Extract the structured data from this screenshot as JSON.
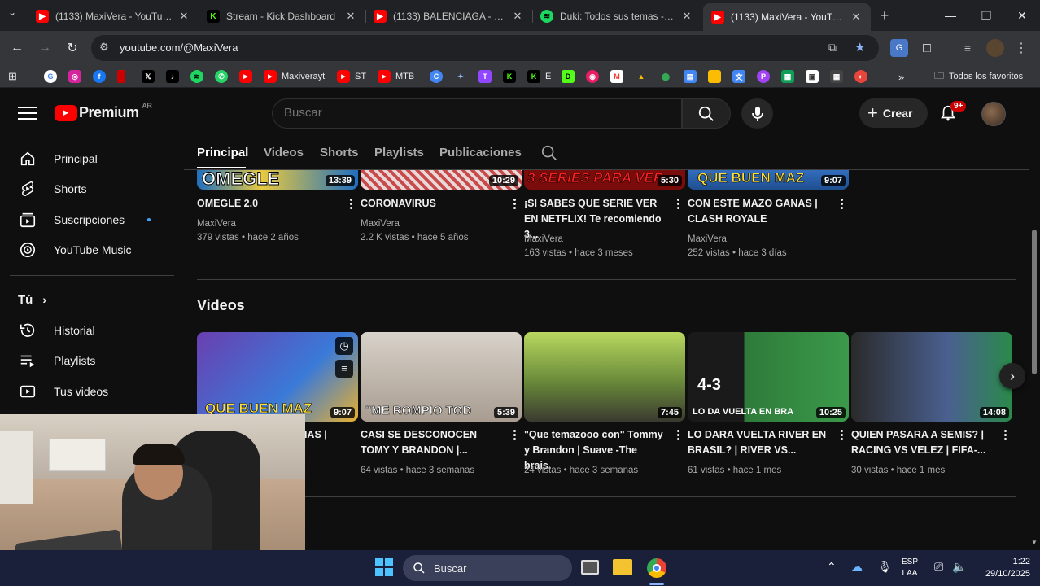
{
  "browser": {
    "tabs": [
      {
        "title": "(1133) MaxiVera - YouTube",
        "favicon": "youtube-icon",
        "color": "#ff0000"
      },
      {
        "title": "Stream - Kick Dashboard",
        "favicon": "kick-icon",
        "color": "#53fc18"
      },
      {
        "title": "(1133) BALENCIAGA - SIZZ",
        "favicon": "youtube-icon",
        "color": "#ff0000"
      },
      {
        "title": "Duki: Todos sus temas - pla",
        "favicon": "spotify-icon",
        "color": "#1ed760"
      },
      {
        "title": "(1133) MaxiVera - YouTube",
        "favicon": "youtube-icon",
        "color": "#ff0000",
        "active": true
      }
    ],
    "new_tab": "+",
    "url": "youtube.com/@MaxiVera",
    "bookmarks": [
      {
        "label": "",
        "icon": "google-icon"
      },
      {
        "label": "",
        "icon": "instagram-icon"
      },
      {
        "label": "",
        "icon": "facebook-icon"
      },
      {
        "label": "",
        "icon": "bookmark-red-icon"
      },
      {
        "label": "",
        "icon": "x-icon"
      },
      {
        "label": "",
        "icon": "tiktok-icon"
      },
      {
        "label": "",
        "icon": "spotify-icon"
      },
      {
        "label": "",
        "icon": "whatsapp-icon"
      },
      {
        "label": "",
        "icon": "youtube-icon"
      },
      {
        "label": "Maxiverayt",
        "icon": "youtube-icon"
      },
      {
        "label": "ST",
        "icon": "youtube-icon"
      },
      {
        "label": "MTB",
        "icon": "youtube-icon"
      },
      {
        "label": "E",
        "icon": "kick-icon"
      }
    ],
    "all_bookmarks": "Todos los favoritos"
  },
  "youtube": {
    "logo_text": "Premium",
    "logo_country": "AR",
    "search_placeholder": "Buscar",
    "create_label": "Crear",
    "notif_count": "9+",
    "sidebar": [
      {
        "label": "Principal",
        "icon": "home-icon"
      },
      {
        "label": "Shorts",
        "icon": "shorts-icon"
      },
      {
        "label": "Suscripciones",
        "icon": "subscriptions-icon"
      },
      {
        "label": "YouTube Music",
        "icon": "youtube-music-icon"
      }
    ],
    "you_section": "Tú",
    "sidebar2": [
      {
        "label": "Historial",
        "icon": "history-icon"
      },
      {
        "label": "Playlists",
        "icon": "playlists-icon"
      },
      {
        "label": "Tus videos",
        "icon": "your-videos-icon"
      }
    ],
    "channel_tabs": [
      "Principal",
      "Videos",
      "Shorts",
      "Playlists",
      "Publicaciones"
    ],
    "row1": [
      {
        "title": "OMEGLE 2.0",
        "channel": "MaxiVera",
        "meta": "379 vistas • hace 2 años",
        "duration": "13:39",
        "thumb_text": "OMEGLE",
        "thumb_color": "#2a8fd8"
      },
      {
        "title": "CORONAVIRUS",
        "channel": "MaxiVera",
        "meta": "2.2 K vistas • hace 5 años",
        "duration": "10:29",
        "thumb_text": "",
        "thumb_color": "#b83a3a"
      },
      {
        "title": "¡SI SABES QUE SERIE VER EN NETFLIX! Te recomiendo 3...",
        "channel": "MaxiVera",
        "meta": "163 vistas • hace 3 meses",
        "duration": "5:30",
        "thumb_text": "3 SERIES PARA VER",
        "thumb_color": "#8a1010"
      },
      {
        "title": "CON ESTE MAZO GANAS | CLASH ROYALE",
        "channel": "MaxiVera",
        "meta": "252 vistas • hace 3 días",
        "duration": "9:07",
        "thumb_text": "QUE BUEN MAZ",
        "thumb_color": "#2a6fb0"
      }
    ],
    "videos_heading": "Videos",
    "row2": [
      {
        "title": "CON ESTE MAZO GANAS | CLASH ROYALE",
        "meta": "",
        "duration": "9:07",
        "thumb_text": "QUE BUEN MAZ",
        "thumb_color": "#4a78c8"
      },
      {
        "title": "CASI SE DESCONOCEN TOMY Y BRANDON |...",
        "meta": "64 vistas • hace 3 semanas",
        "duration": "5:39",
        "thumb_text": "\"ME ROMPIO TOD",
        "thumb_color": "#c9c2b8"
      },
      {
        "title": "\"Que temazooo con\" Tommy y Brandon | Suave -The brais.",
        "meta": "24 vistas • hace 3 semanas",
        "duration": "7:45",
        "thumb_text": "",
        "thumb_color": "#9bbf4a"
      },
      {
        "title": "LO DARA VUELTA RIVER EN BRASIL? | RIVER VS...",
        "meta": "61 vistas • hace 1 mes",
        "duration": "10:25",
        "thumb_text": "LO DA VUELTA EN BRA",
        "thumb_color": "#2d7a2d"
      },
      {
        "title": "QUIEN PASARA A SEMIS? | RACING VS VELEZ | FIFA-...",
        "meta": "30 vistas • hace 1 mes",
        "duration": "14:08",
        "thumb_text": "",
        "thumb_color": "#3a4a6a"
      }
    ]
  },
  "taskbar": {
    "search_label": "Buscar",
    "lang_1": "ESP",
    "lang_2": "LAA",
    "time": "1:22",
    "date": "29/10/2025"
  }
}
